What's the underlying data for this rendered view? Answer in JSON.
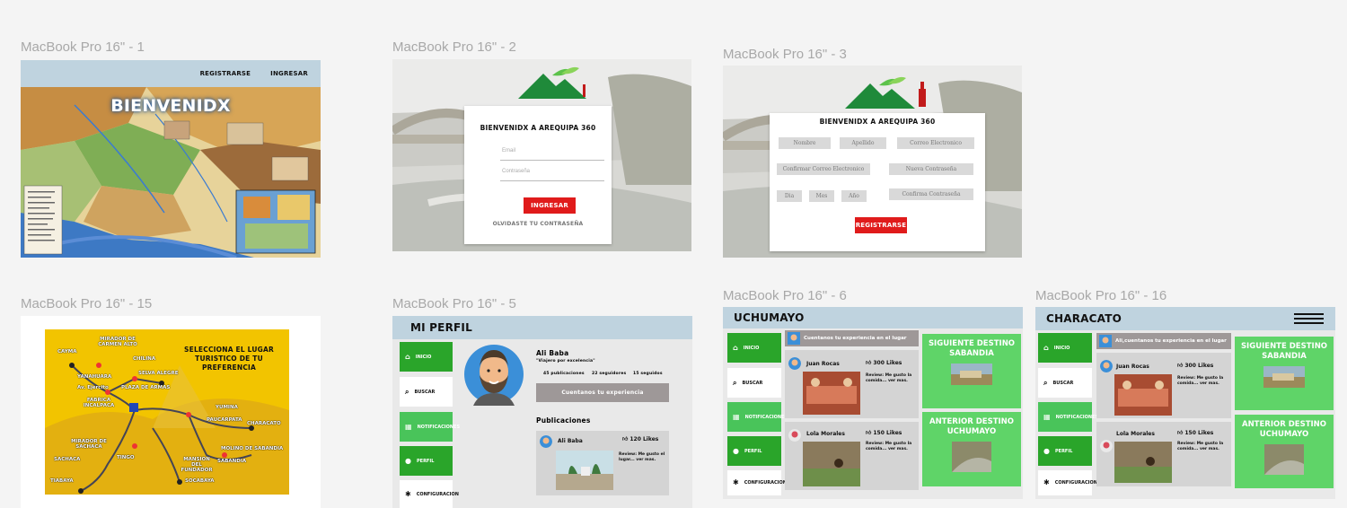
{
  "frames": {
    "f1": {
      "label": "MacBook Pro 16\" - 1",
      "nav": [
        "REGISTRARSE",
        "INGRESAR"
      ],
      "welcome": "BIENVENIDX"
    },
    "f2": {
      "label": "MacBook Pro 16\" - 2",
      "title": "BIENVENIDX A AREQUIPA 360",
      "email_placeholder": "Email",
      "password_placeholder": "Contraseña",
      "login_button": "INGRESAR",
      "forgot": "OLVIDASTE TU CONTRASEÑA"
    },
    "f3": {
      "label": "MacBook Pro 16\" - 3",
      "title": "BIENVENIDX A AREQUIPA 360",
      "fields": {
        "nombre": "Nombre",
        "apellido": "Apellido",
        "correo": "Correo Electronico",
        "confirmar_correo": "Confirmar Correo Electronico",
        "nueva_contrasena": "Nueva Contraseña",
        "dia": "Dia",
        "mes": "Mes",
        "anio": "Año",
        "confirmar_contrasena": "Confirma Contraseña"
      },
      "register_button": "REGISTRARSE"
    },
    "f15": {
      "label": "MacBook Pro 16\" - 15",
      "title": "SELECCIONA EL LUGAR TURISTICO  DE TU PREFERENCIA",
      "places": {
        "cayma": "CAYMA",
        "mirador_carmen": "MIRADOR DE CARMEN ALTO",
        "chilina": "CHILINA",
        "yanahuara": "YANAHUARA",
        "selva_alegre": "SELVA ALEGRE",
        "av_ejercito": "Av. Ejercito",
        "plaza_armas": "PLAZA DE ARMAS",
        "fabrica": "FABRICA INCALPACA",
        "yumina": "YUMINA",
        "paucarpata": "PAUCARPATA",
        "characato": "CHARACATO",
        "mirador_sachaca": "MIRADOR DE SACHACA",
        "sachaca": "SACHACA",
        "tingo": "TINGO",
        "molino": "MOLINO DE SABANDIA",
        "mansion": "MANSION DEL FUNDADOR",
        "sabandia": "SABANDIA",
        "tiabaya": "TIABAYA",
        "socabaya": "SOCABAYA"
      }
    },
    "f5": {
      "label": "MacBook Pro 16\" - 5",
      "header": "MI PERFIL",
      "menu": [
        "INICIO",
        "BUSCAR",
        "NOTIFICACIONES",
        "PERFIL",
        "CONFIGURACION"
      ],
      "user": {
        "name": "Ali Baba",
        "tagline": "\"Viajero por excelencia\"",
        "stats": [
          "45 publicaciones",
          "22 seguidores",
          "15 seguidos"
        ]
      },
      "experience_button": "Cuentanos tu experiencia",
      "posts_heading": "Publicaciones",
      "post": {
        "author": "Ali Baba",
        "likes": "120 Likes",
        "review": "Review: Me gusto el lugar... ver mas."
      }
    },
    "f6": {
      "label": "MacBook Pro 16\" - 6",
      "header": "UCHUMAYO",
      "menu": [
        "INICIO",
        "BUSCAR",
        "NOTIFICACIONES",
        "PERFIL",
        "CONFIGURACION"
      ],
      "experience_bar": "Cuentanos tu experiencia en el lugar",
      "posts": [
        {
          "author": "Juan Rocas",
          "likes": "300 Likes",
          "review": "Review: Me gusto la comida... ver mas."
        },
        {
          "author": "Lola Morales",
          "likes": "150 Likes",
          "review": "Review: Me gusto la comida... ver mas."
        }
      ],
      "next": {
        "label": "SIGUIENTE DESTINO",
        "place": "SABANDIA"
      },
      "prev": {
        "label": "ANTERIOR DESTINO",
        "place": "UCHUMAYO"
      }
    },
    "f16": {
      "label": "MacBook Pro 16\" - 16",
      "header": "CHARACATO",
      "menu": [
        "INICIO",
        "BUSCAR",
        "NOTIFICACIONES",
        "PERFIL",
        "CONFIGURACION"
      ],
      "experience_bar": "Ali,cuentanos tu experiencia en el lugar",
      "posts": [
        {
          "author": "Juan Rocas",
          "likes": "300 Likes",
          "review": "Review: Me gusto la comida... ver mas."
        },
        {
          "author": "Lola Morales",
          "likes": "150 Likes",
          "review": "Review: Me gusto la comida... ver mas."
        }
      ],
      "next": {
        "label": "SIGUIENTE DESTINO",
        "place": "SABANDIA"
      },
      "prev": {
        "label": "ANTERIOR DESTINO",
        "place": "UCHUMAYO"
      }
    }
  },
  "colors": {
    "nav_blue": "#bfd3df",
    "green_dark": "#2aa52a",
    "green_light": "#5fd468",
    "red": "#e01b1b",
    "canvas": "#f4f4f4"
  }
}
